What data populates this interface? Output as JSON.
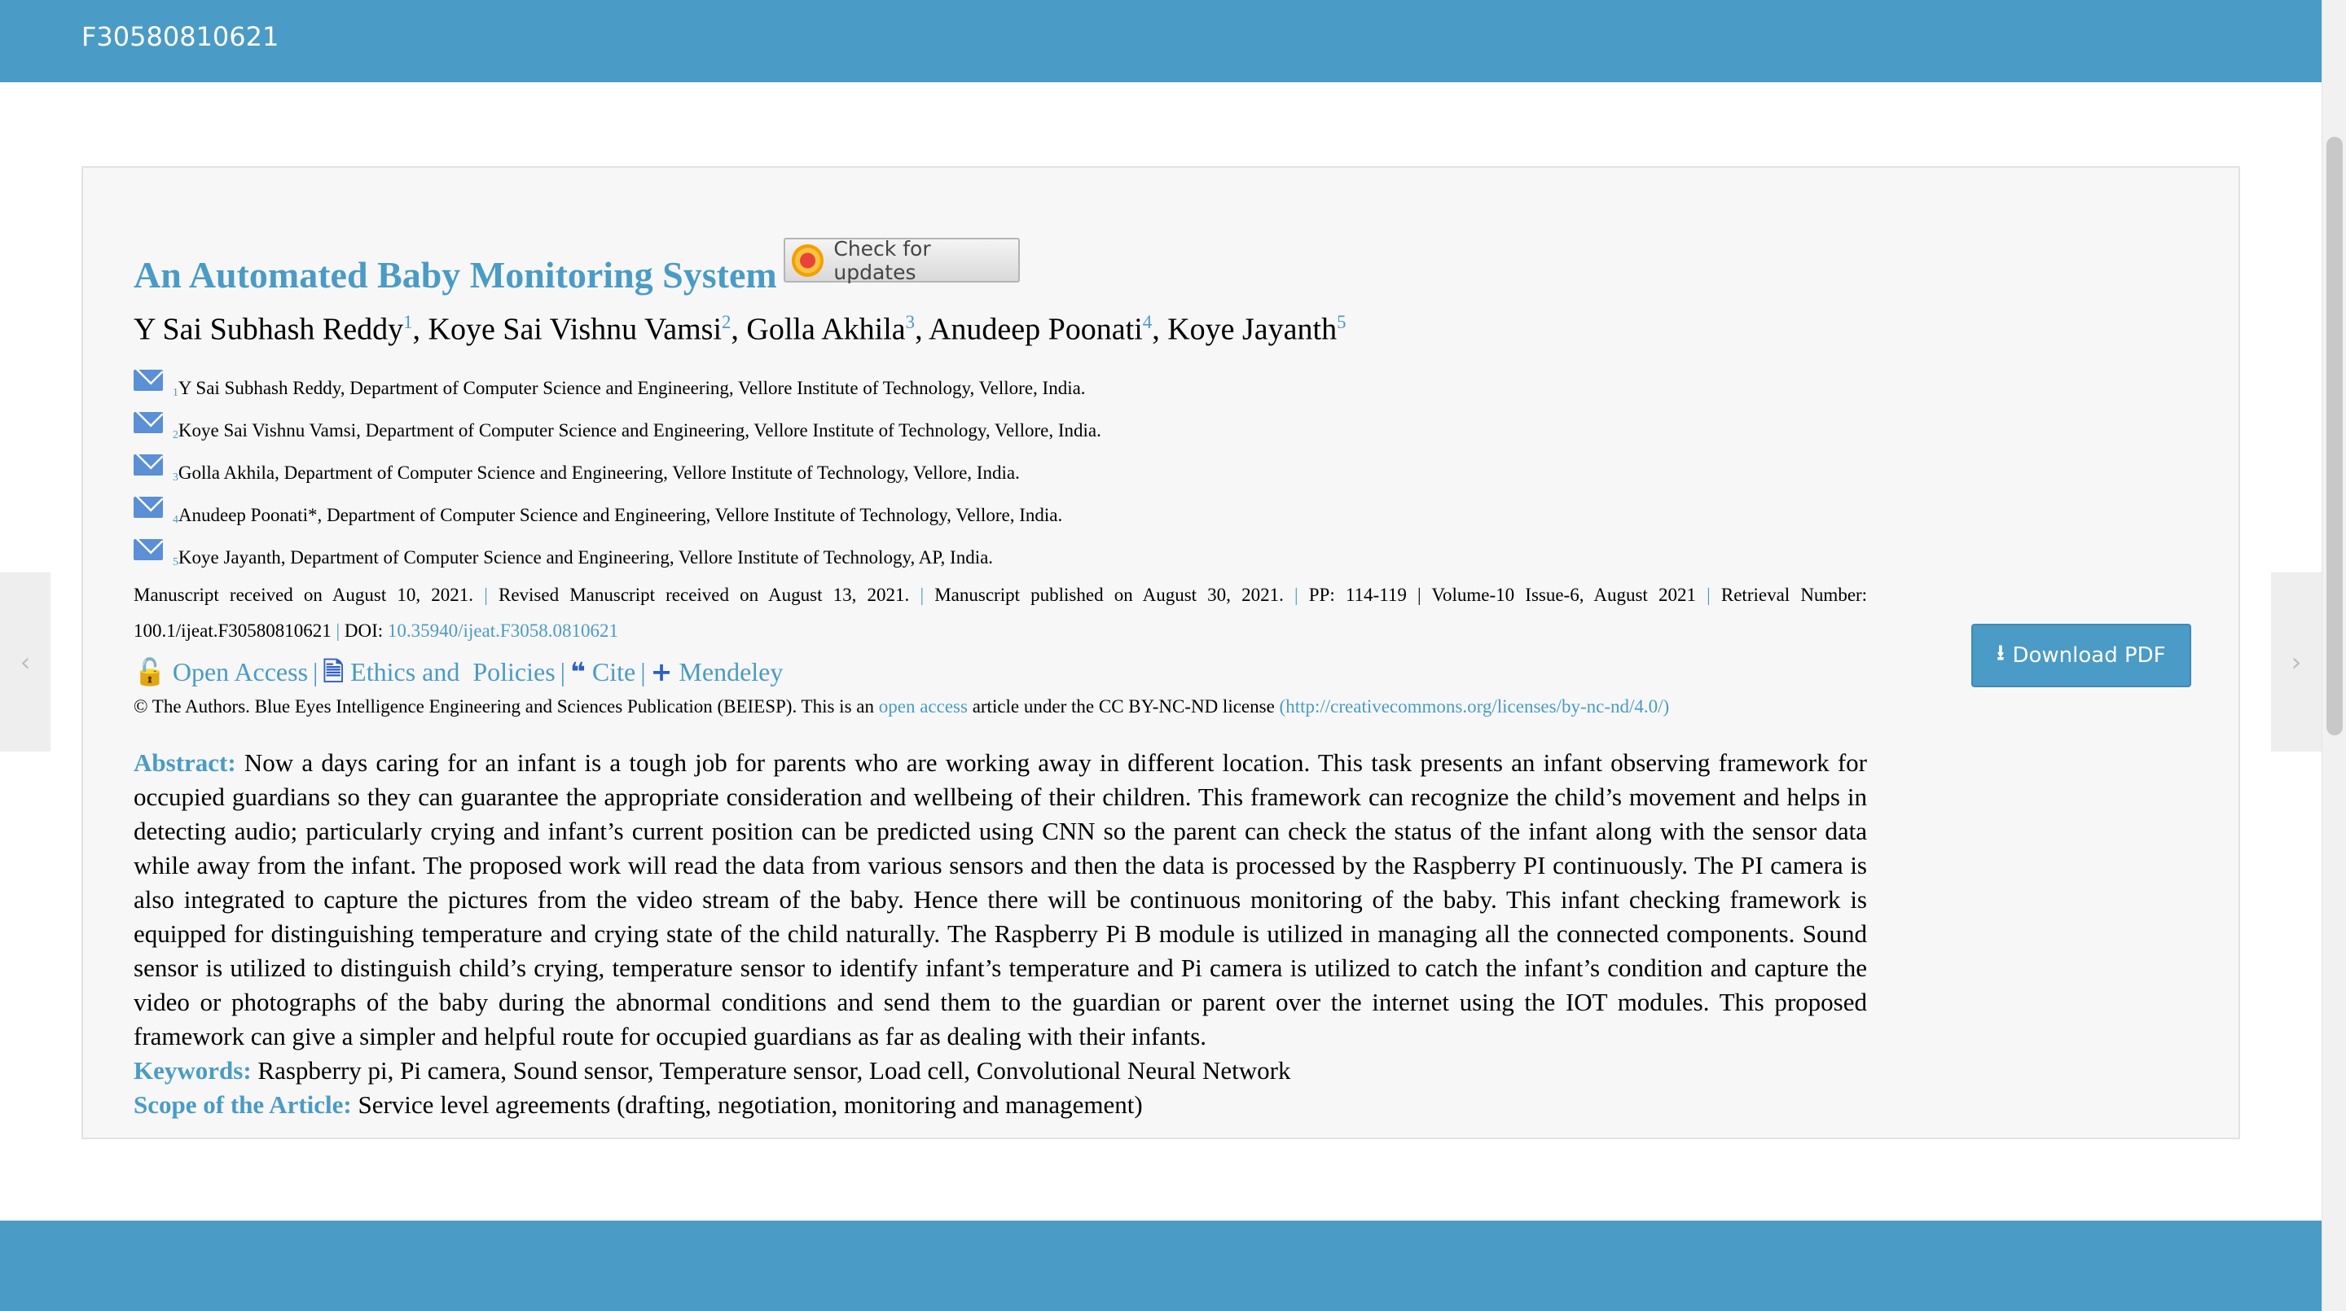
{
  "header": {
    "site_id": "F30580810621"
  },
  "nav": {
    "prev_icon": "‹",
    "next_icon": "›"
  },
  "article": {
    "title": "An Automated Baby Monitoring System",
    "check_updates_label": "Check for updates",
    "authors": [
      {
        "name": "Y Sai Subhash Reddy",
        "sup": "1",
        "sep": ", "
      },
      {
        "name": "Koye Sai Vishnu Vamsi",
        "sup": "2",
        "sep": ", "
      },
      {
        "name": "Golla Akhila",
        "sup": "3",
        "sep": ", "
      },
      {
        "name": "Anudeep Poonati",
        "sup": "4",
        "sep": ", "
      },
      {
        "name": "Koye Jayanth",
        "sup": "5",
        "sep": ""
      }
    ],
    "affiliations": [
      {
        "sup": "1",
        "text": "Y Sai Subhash Reddy, Department of Computer Science and Engineering, Vellore Institute of Technology, Vellore, India."
      },
      {
        "sup": "2",
        "text": "Koye Sai Vishnu Vamsi, Department of Computer Science and Engineering, Vellore Institute of Technology, Vellore, India."
      },
      {
        "sup": "3",
        "text": "Golla Akhila, Department of Computer Science and Engineering, Vellore Institute of Technology, Vellore, India."
      },
      {
        "sup": "4",
        "text": "Anudeep Poonati*, Department of Computer Science and Engineering, Vellore Institute of Technology, Vellore, India."
      },
      {
        "sup": "5",
        "text": "Koye Jayanth, Department of Computer Science and Engineering, Vellore Institute of Technology, AP, India."
      }
    ],
    "meta": {
      "received": "Manuscript received on August 10, 2021.",
      "revised": "Revised Manuscript received on August 13, 2021.",
      "published": "Manuscript published on August 30, 2021.",
      "pages": "PP: 114-119",
      "volume": "Volume-10 Issue-6, August 2021",
      "retrieval_label": "Retrieval Number:",
      "retrieval_number": "100.1/ijeat.F30580810621",
      "doi_label": "DOI:",
      "doi": "10.35940/ijeat.F3058.0810621",
      "sep": "|"
    },
    "actions": {
      "open_access": "Open Access",
      "ethics": "Ethics and  Policies",
      "cite": "Cite",
      "mendeley": "Mendeley",
      "sep": "|",
      "lock_icon": "🔓",
      "doc_icon": "🗎",
      "quote_icon": "❝",
      "plus_icon": "+"
    },
    "license": {
      "prefix": "© The Authors. Blue Eyes Intelligence Engineering and Sciences Publication (BEIESP). This is an",
      "open_access_link": "open access",
      "middle": "article under the CC BY-NC-ND license",
      "url": "(http://creativecommons.org/licenses/by-nc-nd/4.0/)"
    },
    "download_label": "Download PDF",
    "download_icon": "⭳",
    "abstract_label": "Abstract:",
    "abstract": "Now a days caring for an infant is a tough job for parents who are working away in different location. This task presents an infant observing framework for occupied guardians so they can guarantee the appropriate consideration and wellbeing of their children. This framework can recognize the child’s movement and helps in detecting audio; particularly crying and infant’s current position can be predicted using CNN so the parent can check the status of the infant along with the sensor data while away from the infant. The proposed work will read the data from various sensors and then the data is processed by the Raspberry PI continuously. The PI camera is also integrated to capture the pictures from the video stream of the baby. Hence there will be continuous monitoring of the baby. This infant checking framework is equipped for distinguishing temperature and crying state of the child naturally. The Raspberry Pi B module is utilized in managing all the connected components. Sound sensor is utilized to distinguish child’s crying, temperature sensor to identify infant’s temperature and Pi camera is utilized to catch the infant’s condition and capture the video or photographs of the baby during the abnormal conditions and send them to the guardian or parent over the internet using the IOT modules. This proposed framework can give a simpler and helpful route for occupied guardians as far as dealing with their infants.",
    "keywords_label": "Keywords:",
    "keywords": "Raspberry pi, Pi camera, Sound sensor, Temperature sensor, Load cell, Convolutional Neural Network",
    "scope_label": "Scope of the Article:",
    "scope": "Service level agreements (drafting, negotiation, monitoring and management)"
  }
}
